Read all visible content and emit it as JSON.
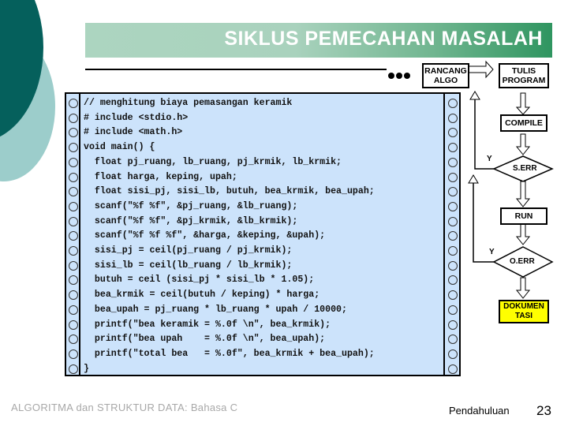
{
  "slide": {
    "title": "SIKLUS PEMECAHAN MASALAH",
    "code_lines": [
      "// menghitung biaya pemasangan keramik",
      "# include <stdio.h>",
      "# include <math.h>",
      "void main() {",
      "  float pj_ruang, lb_ruang, pj_krmik, lb_krmik;",
      "  float harga, keping, upah;",
      "  float sisi_pj, sisi_lb, butuh, bea_krmik, bea_upah;",
      "  scanf(\"%f %f\", &pj_ruang, &lb_ruang);",
      "  scanf(\"%f %f\", &pj_krmik, &lb_krmik);",
      "  scanf(\"%f %f %f\", &harga, &keping, &upah);",
      "  sisi_pj = ceil(pj_ruang / pj_krmik);",
      "  sisi_lb = ceil(lb_ruang / lb_krmik);",
      "  butuh = ceil (sisi_pj * sisi_lb * 1.05);",
      "  bea_krmik = ceil(butuh / keping) * harga;",
      "  bea_upah = pj_ruang * lb_ruang * upah / 10000;",
      "  printf(\"bea keramik = %.0f \\n\", bea_krmik);",
      "  printf(\"bea upah    = %.0f \\n\", bea_upah);",
      "  printf(\"total bea   = %.0f\", bea_krmik + bea_upah);",
      "}"
    ],
    "flowchart": {
      "rancang": "RANCANG\nALGO",
      "tulis": "TULIS\nPROGRAM",
      "compile": "COMPILE",
      "serr": "S.ERR",
      "run": "RUN",
      "oerr": "O.ERR",
      "dokumentasi": "DOKUMEN\nTASI",
      "yes_label_1": "Y",
      "yes_label_2": "Y",
      "dokumentasi_color": "#ffff00"
    },
    "footer": {
      "course": "ALGORITMA dan STRUKTUR DATA: Bahasa C",
      "section": "Pendahuluan",
      "page": "23"
    }
  }
}
